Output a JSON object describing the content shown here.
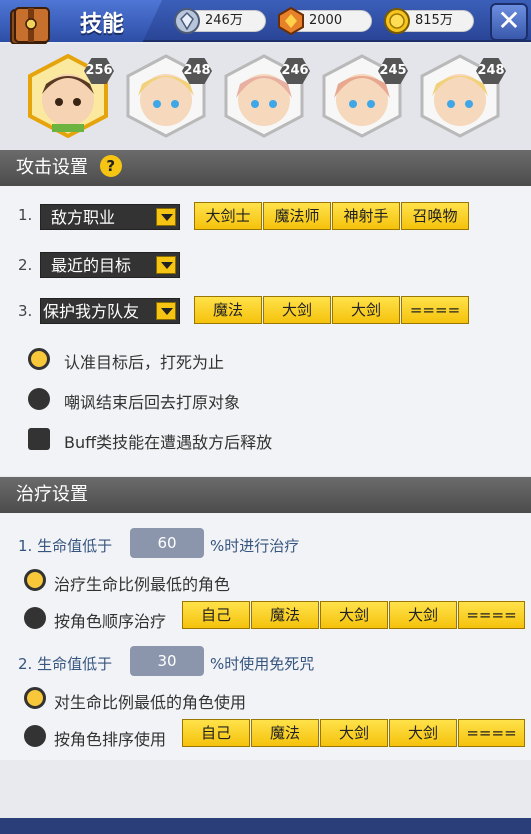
{
  "header": {
    "title": "技能",
    "resources": [
      {
        "icon": "crystal-icon",
        "value": "246万"
      },
      {
        "icon": "gem-badge-icon",
        "value": "2000"
      },
      {
        "icon": "gold-coin-icon",
        "value": "815万"
      }
    ],
    "close_label": "✕"
  },
  "portraits": [
    {
      "level": "256",
      "selected": true,
      "hair": "#5a3a22"
    },
    {
      "level": "248",
      "selected": false,
      "hair": "#f1d27a"
    },
    {
      "level": "246",
      "selected": false,
      "hair": "#e8b0a0"
    },
    {
      "level": "245",
      "selected": false,
      "hair": "#e8a890"
    },
    {
      "level": "248",
      "selected": false,
      "hair": "#f1d27a"
    }
  ],
  "attack": {
    "title": "攻击设置",
    "help": "?",
    "row1": {
      "num": "1.",
      "select": "敌方职业",
      "buttons": [
        "大剑士",
        "魔法师",
        "神射手",
        "召唤物"
      ]
    },
    "row2": {
      "num": "2.",
      "select": "最近的目标"
    },
    "row3": {
      "num": "3.",
      "select": "保护我方队友",
      "buttons": [
        "魔法",
        "大剑",
        "大剑",
        "===="
      ]
    },
    "opt1": "认准目标后，打死为止",
    "opt2": "嘲讽结束后回去打原对象",
    "opt3": "Buff类技能在遭遇敌方后释放"
  },
  "heal": {
    "title": "治疗设置",
    "line1_prefix": "1. 生命值低于",
    "line1_value": "60",
    "line1_suffix": "%时进行治疗",
    "opt1": "治疗生命比例最低的角色",
    "opt2": "按角色顺序治疗",
    "buttons1": [
      "自己",
      "魔法",
      "大剑",
      "大剑",
      "===="
    ],
    "line2_prefix": "2. 生命值低于",
    "line2_value": "30",
    "line2_suffix": "%时使用免死咒",
    "opt3": "对生命比例最低的角色使用",
    "opt4": "按角色排序使用",
    "buttons2": [
      "自己",
      "魔法",
      "大剑",
      "大剑",
      "===="
    ]
  }
}
